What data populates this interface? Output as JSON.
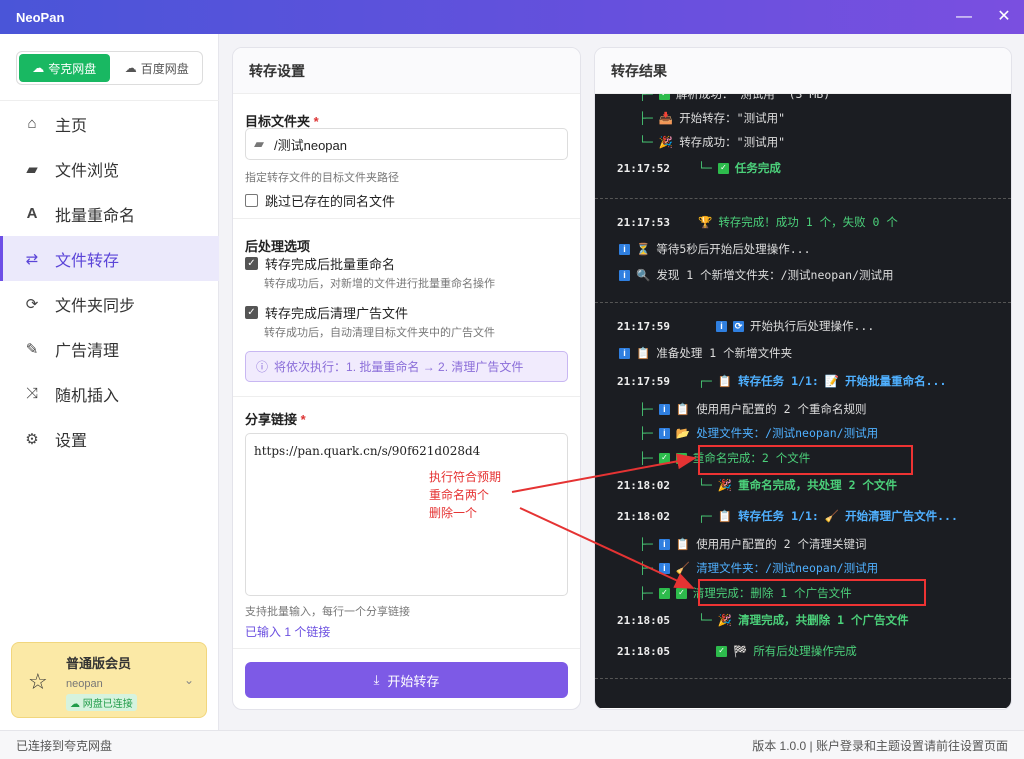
{
  "app": {
    "title": "NeoPan"
  },
  "window": {
    "minimize": "—",
    "close": "✕"
  },
  "sidebar": {
    "tabs": [
      {
        "label": "夸克网盘",
        "icon": "cloud-icon"
      },
      {
        "label": "百度网盘",
        "icon": "cloud-icon"
      }
    ],
    "items": [
      {
        "label": "主页",
        "icon": "home-icon",
        "glyph": "⌂"
      },
      {
        "label": "文件浏览",
        "icon": "folder-icon",
        "glyph": "▰"
      },
      {
        "label": "批量重命名",
        "icon": "font-icon",
        "glyph": "A"
      },
      {
        "label": "文件转存",
        "icon": "swap-icon",
        "glyph": "⇄"
      },
      {
        "label": "文件夹同步",
        "icon": "sync-icon",
        "glyph": "⟳"
      },
      {
        "label": "广告清理",
        "icon": "broom-icon",
        "glyph": "✎"
      },
      {
        "label": "随机插入",
        "icon": "shuffle-icon",
        "glyph": "⤨"
      },
      {
        "label": "设置",
        "icon": "gear-icon",
        "glyph": "⚙"
      }
    ],
    "active_index": 3,
    "member": {
      "title": "普通版会员",
      "user": "neopan",
      "badge": "网盘已连接"
    }
  },
  "settings": {
    "heading": "转存设置",
    "target_label": "目标文件夹",
    "required_mark": "*",
    "target_value": "/测试neopan",
    "target_hint": "指定转存文件的目标文件夹路径",
    "skip_label": "跳过已存在的同名文件",
    "skip_checked": false,
    "post_label": "后处理选项",
    "rename_label": "转存完成后批量重命名",
    "rename_sub": "转存成功后，对新增的文件进行批量重命名操作",
    "rename_checked": true,
    "clean_label": "转存完成后清理广告文件",
    "clean_sub": "转存成功后，自动清理目标文件夹中的广告文件",
    "clean_checked": true,
    "order_info": "将依次执行：1. 批量重命名 → 2. 清理广告文件",
    "share_label": "分享链接",
    "share_value": "https://pan.quark.cn/s/90f621d028d4",
    "share_hint": "支持批量输入，每行一个分享链接",
    "link_count": "已输入 1 个链接",
    "start_button": "开始转存"
  },
  "results": {
    "heading": "转存结果",
    "lines": {
      "l1": "解析成功：\"测试用\" (3 MB)",
      "l2": "开始转存：\"测试用\"",
      "l3": "转存成功：\"测试用\"",
      "l4_ts": "21:17:52",
      "l4": "任务完成",
      "l5_ts": "21:17:53",
      "l5": "转存完成！成功 1 个，失败 0 个",
      "l6": "等待5秒后开始后处理操作...",
      "l7": "发现 1 个新增文件夹：/测试neopan/测试用",
      "l8_ts": "21:17:59",
      "l8": "开始执行后处理操作...",
      "l9": "准备处理 1 个新增文件夹",
      "l10_ts": "21:17:59",
      "l10a": "转存任务 1/1:",
      "l10b": "开始批量重命名...",
      "l11": "使用用户配置的 2 个重命名规则",
      "l12": "处理文件夹：/测试neopan/测试用",
      "l13": "重命名完成：2 个文件",
      "l14_ts": "21:18:02",
      "l14": "重命名完成，共处理 2 个文件",
      "l15_ts": "21:18:02",
      "l15a": "转存任务 1/1:",
      "l15b": "开始清理广告文件...",
      "l16": "使用用户配置的 2 个清理关键词",
      "l17": "清理文件夹：/测试neopan/测试用",
      "l18": "清理完成：删除 1 个广告文件",
      "l19_ts": "21:18:05",
      "l19": "清理完成，共删除 1 个广告文件",
      "l20_ts": "21:18:05",
      "l20": "所有后处理操作完成"
    },
    "annotation": [
      "执行符合预期",
      "重命名两个",
      "删除一个"
    ]
  },
  "status": {
    "left": "已连接到夸克网盘",
    "right": "版本 1.0.0 | 账户登录和主题设置请前往设置页面"
  },
  "colors": {
    "accent": "#7d5ae6",
    "green": "#19b862",
    "annotation": "#e53333"
  }
}
